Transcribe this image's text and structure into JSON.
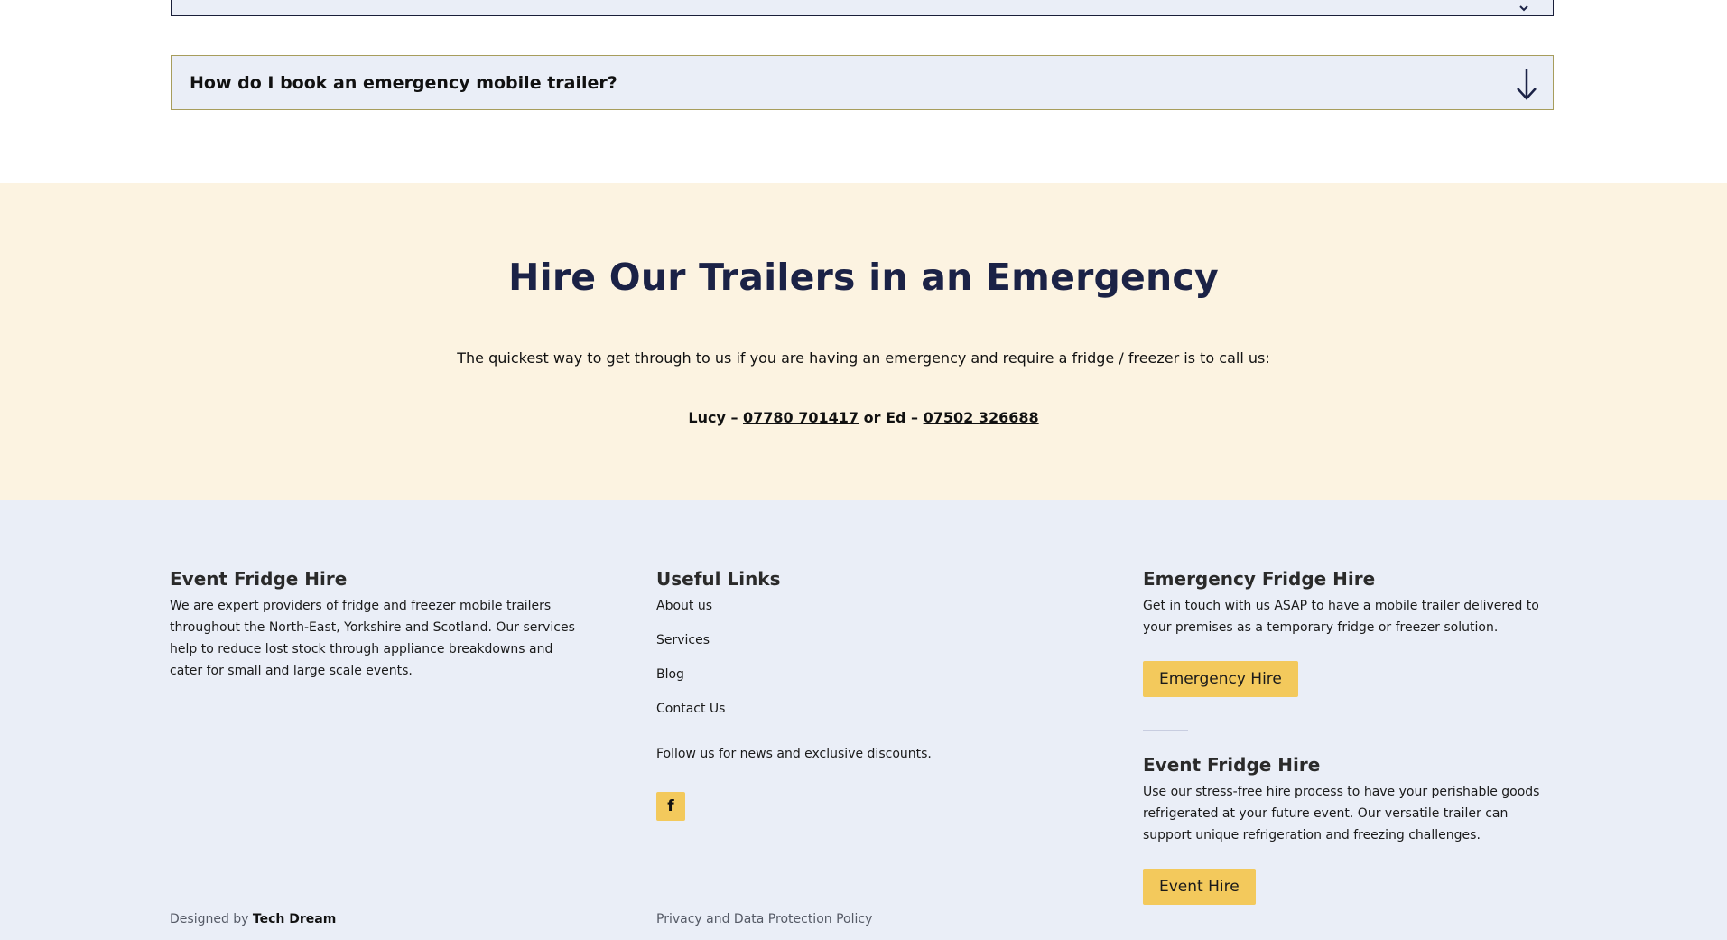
{
  "faq": {
    "question": "How do I book an emergency mobile trailer?"
  },
  "emergency": {
    "title": "Hire Our Trailers in an Emergency",
    "lead": "The quickest way to get through to us if you are having an emergency and require a fridge / freezer is to call us:",
    "contact1_prefix": "Lucy – ",
    "contact1_phone": "07780 701417",
    "contact_between": " or Ed – ",
    "contact2_phone": "07502 326688"
  },
  "footer": {
    "col1": {
      "title": "Event Fridge Hire",
      "text": "We are expert providers of fridge and freezer mobile trailers throughout the North-East, Yorkshire and Scotland. Our services help to reduce lost stock through appliance breakdowns and cater for small and large scale events."
    },
    "col2": {
      "title": "Useful Links",
      "links": [
        "About us",
        "Services",
        "Blog",
        "Contact Us"
      ],
      "follow": "Follow us for news and exclusive discounts.",
      "facebook_label": "f"
    },
    "col3": {
      "title1": "Emergency Fridge Hire",
      "text1": "Get in touch with us ASAP to have a mobile trailer delivered to your premises as a temporary fridge or freezer solution.",
      "button1": "Emergency Hire",
      "title2": "Event Fridge Hire",
      "text2": "Use our stress-free hire process to have your perishable goods refrigerated at your future event. Our versatile trailer can support unique refrigeration and freezing challenges.",
      "button2": "Event Hire"
    },
    "bottom": {
      "designed_by": "Designed by ",
      "designer": "Tech Dream",
      "policy": "Privacy and Data Protection Policy"
    }
  },
  "colors": {
    "navy": "#1b2246",
    "cream": "#fcf3e1",
    "footer_bg": "#eaeef7",
    "button_yellow": "#f3c95c"
  }
}
